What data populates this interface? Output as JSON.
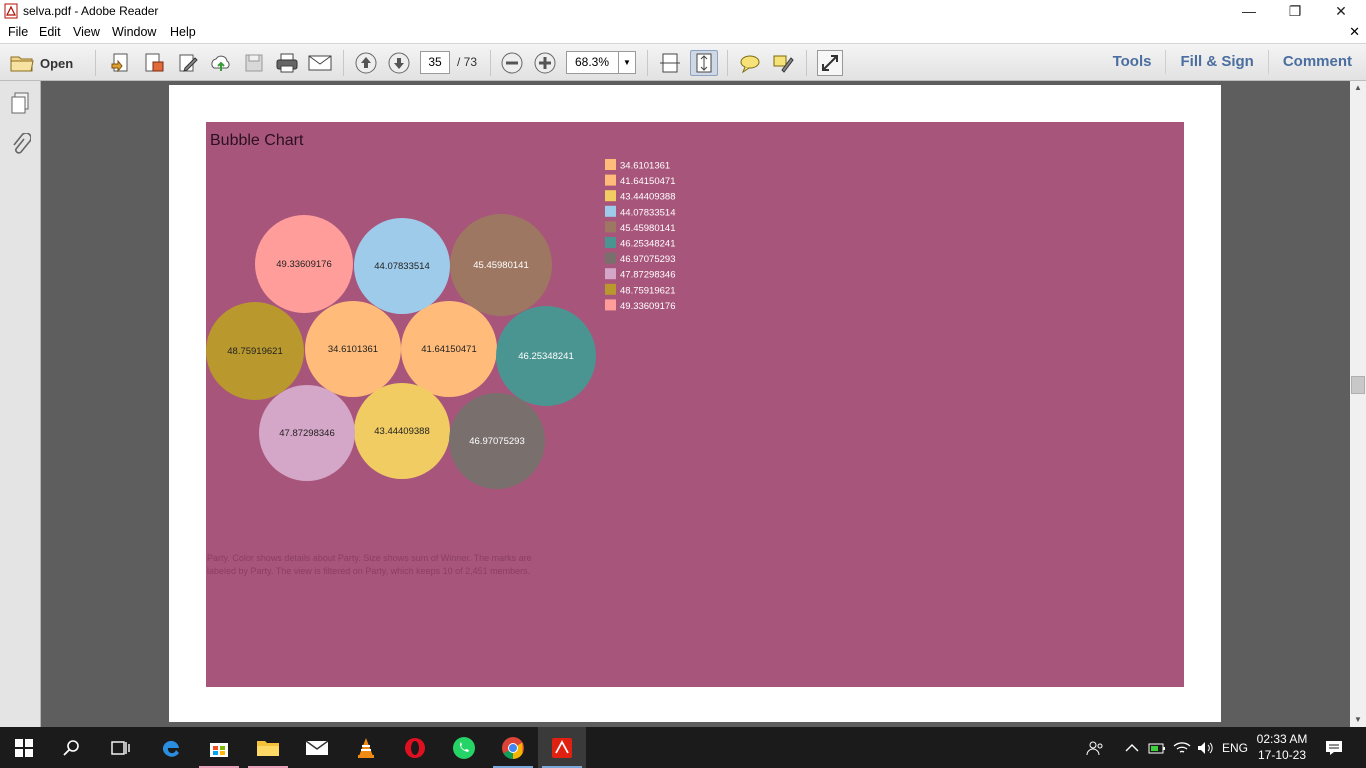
{
  "window": {
    "title": "selva.pdf - Adobe Reader"
  },
  "menu": [
    "File",
    "Edit",
    "View",
    "Window",
    "Help"
  ],
  "toolbar": {
    "open_label": "Open",
    "page_current": "35",
    "page_total": "/ 73",
    "zoom": "68.3%",
    "tools_label": "Tools",
    "fill_sign_label": "Fill & Sign",
    "comment_label": "Comment"
  },
  "chart_data": {
    "type": "bubble",
    "title": "Bubble Chart",
    "series": [
      {
        "label": "34.6101361",
        "color": "#ffbb7a"
      },
      {
        "label": "41.64150471",
        "color": "#ffbb7a"
      },
      {
        "label": "43.44409388",
        "color": "#f0cc63"
      },
      {
        "label": "44.07833514",
        "color": "#9fcbea"
      },
      {
        "label": "45.45980141",
        "color": "#9e7762"
      },
      {
        "label": "46.25348241",
        "color": "#4a9591"
      },
      {
        "label": "46.97075293",
        "color": "#79706e"
      },
      {
        "label": "47.87298346",
        "color": "#d4a6c8"
      },
      {
        "label": "48.75919621",
        "color": "#b9982e"
      },
      {
        "label": "49.33609176",
        "color": "#ff9d9a"
      }
    ],
    "legend_placement": "top-right of chart",
    "caption": "Party.  Color shows details about Party.  Size shows sum of Winner.  The marks are labeled by Party. The view is filtered on Party, which keeps 10 of 2,451 members."
  },
  "taskbar": {
    "time": "02:33 AM",
    "date": "17-10-23",
    "lang": "ENG"
  }
}
